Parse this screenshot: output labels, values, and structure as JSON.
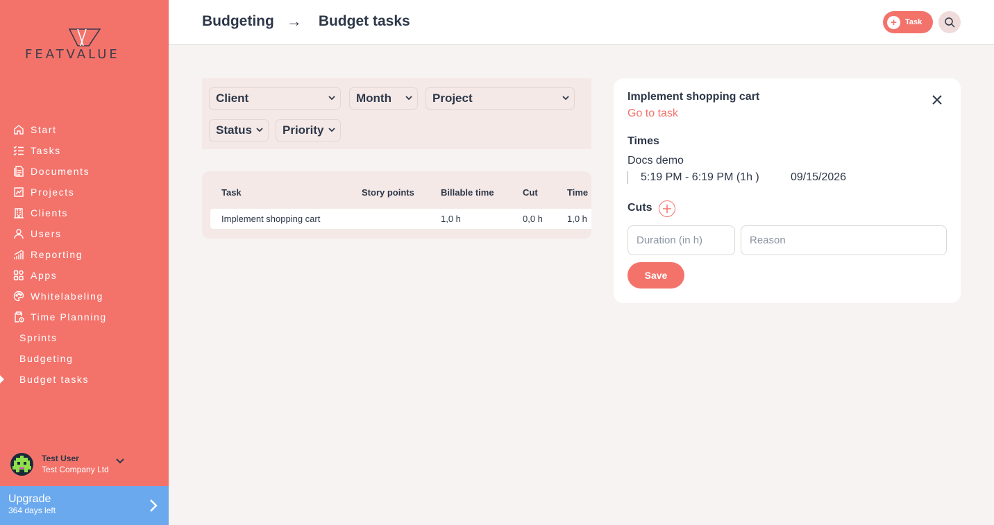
{
  "brand": {
    "name": "FEATVALUE"
  },
  "sidebar": {
    "items": [
      {
        "label": "Start",
        "icon": "home-icon"
      },
      {
        "label": "Tasks",
        "icon": "tasks-icon"
      },
      {
        "label": "Documents",
        "icon": "documents-icon"
      },
      {
        "label": "Projects",
        "icon": "projects-icon"
      },
      {
        "label": "Clients",
        "icon": "clients-icon"
      },
      {
        "label": "Users",
        "icon": "users-icon"
      },
      {
        "label": "Reporting",
        "icon": "reporting-icon"
      },
      {
        "label": "Apps",
        "icon": "apps-icon"
      },
      {
        "label": "Whitelabeling",
        "icon": "palette-icon"
      },
      {
        "label": "Time Planning",
        "icon": "clipboard-clock-icon"
      }
    ],
    "subitems": [
      {
        "label": "Sprints"
      },
      {
        "label": "Budgeting"
      },
      {
        "label": "Budget tasks",
        "active": true
      }
    ],
    "user": {
      "name": "Test User",
      "company": "Test Company Ltd"
    },
    "upgrade": {
      "title": "Upgrade",
      "subtitle": "364 days left"
    }
  },
  "header": {
    "breadcrumb": [
      "Budgeting",
      "Budget tasks"
    ],
    "breadcrumb_separator": "→",
    "task_button": "Task"
  },
  "filters": {
    "client": "Client",
    "month": "Month",
    "project": "Project",
    "status": "Status",
    "priority": "Priority"
  },
  "table": {
    "columns": [
      "Task",
      "Story points",
      "Billable time",
      "Cut",
      "Time"
    ],
    "rows": [
      {
        "task": "Implement shopping cart",
        "story_points": "",
        "billable_time": "1,0 h",
        "cut": "0,0 h",
        "time": "1,0 h"
      }
    ]
  },
  "detail": {
    "title": "Implement shopping cart",
    "link": "Go to task",
    "times_heading": "Times",
    "entry_name": "Docs demo",
    "entry_range": "5:19 PM - 6:19 PM (1h )",
    "entry_date": "09/15/2026",
    "cuts_heading": "Cuts",
    "duration_placeholder": "Duration (in h)",
    "reason_placeholder": "Reason",
    "save_label": "Save"
  },
  "colors": {
    "accent": "#f3736b",
    "upgrade": "#6ba9ef",
    "background": "#f7f3f2",
    "text": "#2d3748"
  }
}
